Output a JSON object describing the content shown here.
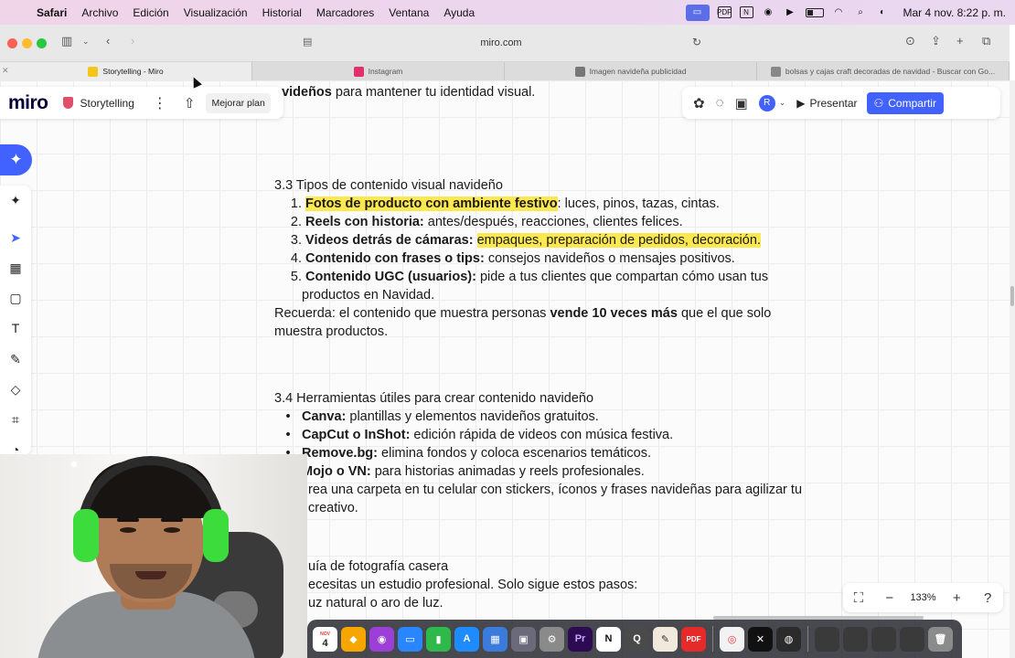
{
  "menubar": {
    "app_name": "Safari",
    "menus": [
      "Archivo",
      "Edición",
      "Visualización",
      "Historial",
      "Marcadores",
      "Ventana",
      "Ayuda"
    ],
    "clock": "Mar 4 nov.  8:22 p. m."
  },
  "browser": {
    "url": "miro.com",
    "tabs": [
      {
        "label": "Storytelling - Miro",
        "favicon_color": "#f5c518",
        "active": true
      },
      {
        "label": "Instagram",
        "favicon_color": "#e1306c",
        "active": false
      },
      {
        "label": "Imagen navideña publicidad",
        "favicon_color": "#777777",
        "active": false
      },
      {
        "label": "bolsas y cajas craft decoradas de navidad - Buscar con Go...",
        "favicon_color": "#888888",
        "active": false
      }
    ]
  },
  "miro": {
    "logo": "miro",
    "board_name": "Storytelling",
    "upgrade_label": "Mejorar plan",
    "present_label": "Presentar",
    "share_label": "Compartir",
    "avatar_initial": "R",
    "zoom_level": "133%",
    "accent_color": "#4262ff"
  },
  "document": {
    "top_line_bold": "avideños",
    "top_line_rest": " para mantener tu identidad visual.",
    "section_33": {
      "heading": "3.3 Tipos de contenido visual navideño",
      "items": [
        {
          "num": "1.",
          "bold": "Fotos de producto con ambiente festivo",
          "highlight_bold": true,
          "rest": ": luces, pinos, tazas, cintas."
        },
        {
          "num": "2.",
          "bold": "Reels con historia:",
          "rest": " antes/después, reacciones, clientes felices."
        },
        {
          "num": "3.",
          "bold": "Videos detrás de cámaras:",
          "highlight_rest": "empaques, preparación de pedidos, decoración."
        },
        {
          "num": "4.",
          "bold": "Contenido con frases o tips:",
          "rest": " consejos navideños o mensajes positivos."
        },
        {
          "num": "5.",
          "bold": "Contenido UGC (usuarios):",
          "rest": " pide a tus clientes que compartan cómo usan tus",
          "rest_line2": "productos en Navidad."
        }
      ],
      "note_prefix": " Recuerda: el contenido que muestra personas ",
      "note_bold": "vende 10 veces más",
      "note_suffix": " que el que solo",
      "note_line2": "muestra productos."
    },
    "section_34": {
      "heading": "3.4 Herramientas útiles para crear contenido navideño",
      "items": [
        {
          "bold": "Canva:",
          "rest": " plantillas y elementos navideños gratuitos."
        },
        {
          "bold": "CapCut o InShot:",
          "rest": " edición rápida de videos con música festiva."
        },
        {
          "bold": "Remove.bg:",
          "rest": " elimina fondos y coloca escenarios temáticos."
        },
        {
          "bold": "Mojo o VN:",
          "rest": " para historias animadas y reels profesionales."
        },
        {
          "rest": "rea una carpeta en tu celular con stickers, íconos y frases navideñas para agilizar tu"
        }
      ],
      "trailing_line": "creativo."
    },
    "section_35": {
      "heading_partial": "uía de fotografía casera",
      "line1": "ecesitas un estudio profesional. Solo sigue estos pasos:",
      "line2": "uz natural o aro de luz."
    }
  },
  "dock": {
    "calendar_month": "NOV",
    "calendar_day": "4",
    "apps": [
      {
        "icon": "sketch-icon",
        "color": "#f7a600"
      },
      {
        "icon": "podcasts-icon",
        "color": "#9b3fd6"
      },
      {
        "icon": "keynote-icon",
        "color": "#2a86ff"
      },
      {
        "icon": "numbers-icon",
        "color": "#2fb94a"
      },
      {
        "icon": "app-store-icon",
        "color": "#1e8cff"
      },
      {
        "icon": "sheets-icon",
        "color": "#3b7bdb"
      },
      {
        "icon": "screenshot-icon",
        "color": "#6a6a7a"
      },
      {
        "icon": "settings-icon",
        "color": "#8a8a8a"
      },
      {
        "icon": "premiere-icon",
        "color": "#2c0b53",
        "label": "Pr"
      },
      {
        "icon": "notion-icon",
        "color": "#ffffff",
        "label": "N"
      },
      {
        "icon": "quicktime-icon",
        "color": "#4a4a4a"
      },
      {
        "icon": "pencil-icon",
        "color": "#f0e9dc"
      },
      {
        "icon": "pdf-icon",
        "color": "#e52a2a",
        "label": "PDF"
      },
      {
        "icon": "chrome-icon",
        "color": "#f2f2f2"
      },
      {
        "icon": "capcut-icon",
        "color": "#111111"
      },
      {
        "icon": "obs-icon",
        "color": "#2b2b2b"
      }
    ]
  }
}
